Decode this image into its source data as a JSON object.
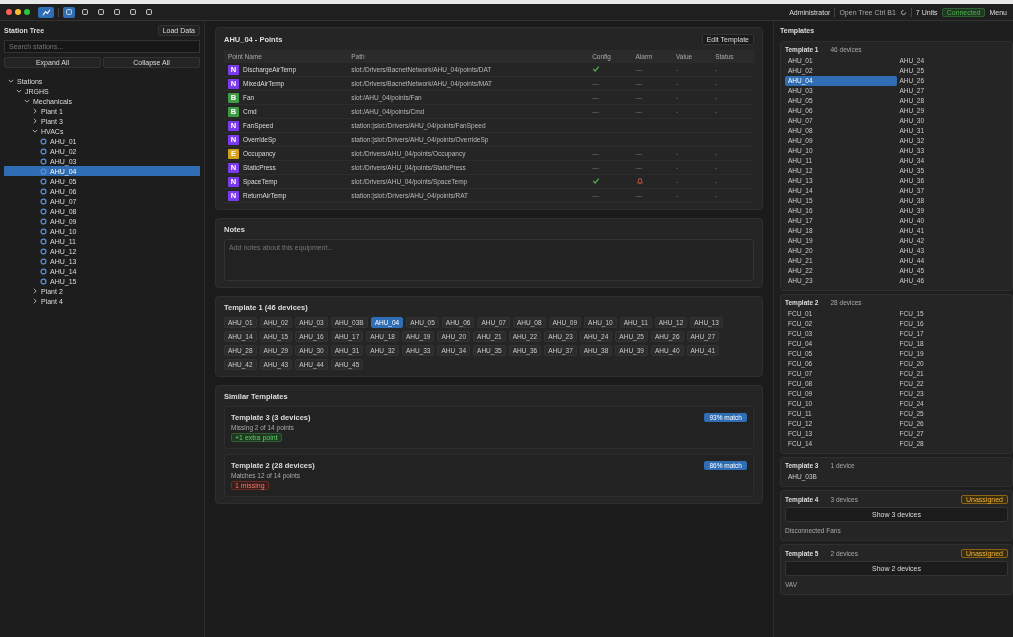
{
  "toolbar": {
    "tools": [
      {
        "selected": true
      },
      {
        "selected": false
      },
      {
        "selected": false
      },
      {
        "selected": false
      },
      {
        "selected": false
      },
      {
        "selected": false
      }
    ],
    "right": {
      "user": "Administrator",
      "workspace": "Open Tree Ctrl B1",
      "units": "7 Units",
      "status": "Connected",
      "menu": "Menu"
    }
  },
  "sidebar": {
    "title": "Station Tree",
    "load_button": "Load Data",
    "search": {
      "placeholder": "Search stations..."
    },
    "expand_button": "Expand All",
    "collapse_button": "Collapse All",
    "tree": [
      {
        "label": "Stations",
        "expanded": true,
        "selected": false,
        "children": [
          {
            "label": "JRGHS",
            "expanded": true,
            "selected": false,
            "children": [
              {
                "label": "Mechanicals",
                "expanded": true,
                "selected": false,
                "children": [
                  {
                    "label": "Plant 1",
                    "expanded": false,
                    "selected": false
                  },
                  {
                    "label": "Plant 3",
                    "expanded": false,
                    "selected": false
                  },
                  {
                    "label": "HVACs",
                    "expanded": true,
                    "selected": false,
                    "children": [
                      {
                        "label": "AHU_01",
                        "selected": false
                      },
                      {
                        "label": "AHU_02",
                        "selected": false
                      },
                      {
                        "label": "AHU_03",
                        "selected": false
                      },
                      {
                        "label": "AHU_04",
                        "selected": true
                      },
                      {
                        "label": "AHU_05",
                        "selected": false
                      },
                      {
                        "label": "AHU_06",
                        "selected": false
                      },
                      {
                        "label": "AHU_07",
                        "selected": false
                      },
                      {
                        "label": "AHU_08",
                        "selected": false
                      },
                      {
                        "label": "AHU_09",
                        "selected": false
                      },
                      {
                        "label": "AHU_10",
                        "selected": false
                      },
                      {
                        "label": "AHU_11",
                        "selected": false
                      },
                      {
                        "label": "AHU_12",
                        "selected": false
                      },
                      {
                        "label": "AHU_13",
                        "selected": false
                      },
                      {
                        "label": "AHU_14",
                        "selected": false
                      },
                      {
                        "label": "AHU_15",
                        "selected": false
                      }
                    ]
                  },
                  {
                    "label": "Plant 2",
                    "expanded": false,
                    "selected": false
                  },
                  {
                    "label": "Plant 4",
                    "expanded": false,
                    "selected": false
                  }
                ]
              }
            ]
          }
        ]
      }
    ]
  },
  "points": {
    "title": "AHU_04 - Points",
    "edit_button": "Edit Template",
    "columns": [
      "Point Name",
      "Path",
      "Config",
      "Alarm",
      "Value",
      "Status"
    ],
    "rows": [
      {
        "type": "N",
        "name": "DischargeAirTemp",
        "path": "slot:/Drivers/BacnetNetwork/AHU_04/points/DAT",
        "configured": true,
        "alarm": "—",
        "value": "-",
        "status": "-"
      },
      {
        "type": "N",
        "name": "MixedAirTemp",
        "path": "slot:/Drivers/BacnetNetwork/AHU_04/points/MAT",
        "config": "—",
        "alarm": "—",
        "value": "-",
        "status": "-"
      },
      {
        "type": "B",
        "name": "Fan",
        "path": "slot:/AHU_04/points/Fan",
        "config": "—",
        "alarm": "—",
        "value": "-",
        "status": "-"
      },
      {
        "type": "B",
        "name": "Cmd",
        "path": "slot:/AHU_04/points/Cmd",
        "config": "—",
        "alarm": "—",
        "value": "-",
        "status": "-"
      },
      {
        "type": "N",
        "name": "FanSpeed",
        "path": "station:|slot:/Drivers/AHU_04/points/FanSpeed"
      },
      {
        "type": "N",
        "name": "OverrideSp",
        "path": "station:|slot:/Drivers/AHU_04/points/OverrideSp"
      },
      {
        "type": "E",
        "name": "Occupancy",
        "path": "slot:/Drivers/AHU_04/points/Occupancy",
        "config": "—",
        "alarm": "—",
        "value": "-",
        "status": "-"
      },
      {
        "type": "N",
        "name": "StaticPress",
        "path": "slot:/Drivers/AHU_04/points/StaticPress",
        "config": "—",
        "alarm": "—",
        "value": "-",
        "status": "-"
      },
      {
        "type": "N",
        "name": "SpaceTemp",
        "path": "slot:/Drivers/AHU_04/points/SpaceTemp",
        "configured": true,
        "alarm_active": true,
        "value": "-",
        "status": "-"
      },
      {
        "type": "N",
        "name": "ReturnAirTemp",
        "path": "station:|slot:/Drivers/AHU_04/points/RAT",
        "config": "—",
        "alarm": "—",
        "value": "-",
        "status": "-"
      }
    ]
  },
  "notes": {
    "title": "Notes",
    "placeholder": "Add notes about this equipment..."
  },
  "template_devices": {
    "title": "Template 1 (46 devices)",
    "devices": [
      {
        "label": "AHU_01",
        "selected": false
      },
      {
        "label": "AHU_02",
        "selected": false
      },
      {
        "label": "AHU_03",
        "selected": false
      },
      {
        "label": "AHU_03B",
        "selected": false
      },
      {
        "label": "AHU_04",
        "selected": true
      },
      {
        "label": "AHU_05",
        "selected": false
      },
      {
        "label": "AHU_06",
        "selected": false
      },
      {
        "label": "AHU_07",
        "selected": false
      },
      {
        "label": "AHU_08",
        "selected": false
      },
      {
        "label": "AHU_09",
        "selected": false
      },
      {
        "label": "AHU_10",
        "selected": false
      },
      {
        "label": "AHU_11",
        "selected": false
      },
      {
        "label": "AHU_12",
        "selected": false
      },
      {
        "label": "AHU_13",
        "selected": false
      },
      {
        "label": "AHU_14",
        "selected": false
      },
      {
        "label": "AHU_15",
        "selected": false
      },
      {
        "label": "AHU_16",
        "selected": false
      },
      {
        "label": "AHU_17",
        "selected": false
      },
      {
        "label": "AHU_18",
        "selected": false
      },
      {
        "label": "AHU_19",
        "selected": false
      },
      {
        "label": "AHU_20",
        "selected": false
      },
      {
        "label": "AHU_21",
        "selected": false
      },
      {
        "label": "AHU_22",
        "selected": false
      },
      {
        "label": "AHU_23",
        "selected": false
      },
      {
        "label": "AHU_24",
        "selected": false
      },
      {
        "label": "AHU_25",
        "selected": false
      },
      {
        "label": "AHU_26",
        "selected": false
      },
      {
        "label": "AHU_27",
        "selected": false
      },
      {
        "label": "AHU_28",
        "selected": false
      },
      {
        "label": "AHU_29",
        "selected": false
      },
      {
        "label": "AHU_30",
        "selected": false
      },
      {
        "label": "AHU_31",
        "selected": false
      },
      {
        "label": "AHU_32",
        "selected": false
      },
      {
        "label": "AHU_33",
        "selected": false
      },
      {
        "label": "AHU_34",
        "selected": false
      },
      {
        "label": "AHU_35",
        "selected": false
      },
      {
        "label": "AHU_36",
        "selected": false
      },
      {
        "label": "AHU_37",
        "selected": false
      },
      {
        "label": "AHU_38",
        "selected": false
      },
      {
        "label": "AHU_39",
        "selected": false
      },
      {
        "label": "AHU_40",
        "selected": false
      },
      {
        "label": "AHU_41",
        "selected": false
      },
      {
        "label": "AHU_42",
        "selected": false
      },
      {
        "label": "AHU_43",
        "selected": false
      },
      {
        "label": "AHU_44",
        "selected": false
      },
      {
        "label": "AHU_45",
        "selected": false
      }
    ]
  },
  "similar": {
    "title": "Similar Templates",
    "items": [
      {
        "name": "Template 3 (3 devices)",
        "detail": "Missing 2 of 14 points",
        "tag": "+1 extra point",
        "kind": "extra",
        "match": "93% match"
      },
      {
        "name": "Template 2 (28 devices)",
        "detail": "Matches 12 of 14 points",
        "tag": "1 missing",
        "kind": "missing",
        "match": "86% match"
      }
    ]
  },
  "templates": {
    "title": "Templates",
    "items": [
      {
        "kind": "list",
        "name": "Template 1",
        "count": "46 devices",
        "devices": [
          {
            "label": "AHU_01",
            "selected": false
          },
          {
            "label": "AHU_24",
            "selected": false
          },
          {
            "label": "AHU_02",
            "selected": false
          },
          {
            "label": "AHU_25",
            "selected": false
          },
          {
            "label": "AHU_04",
            "selected": true
          },
          {
            "label": "AHU_26",
            "selected": false
          },
          {
            "label": "AHU_03",
            "selected": false
          },
          {
            "label": "AHU_27",
            "selected": false
          },
          {
            "label": "AHU_05",
            "selected": false
          },
          {
            "label": "AHU_28",
            "selected": false
          },
          {
            "label": "AHU_06",
            "selected": false
          },
          {
            "label": "AHU_29",
            "selected": false
          },
          {
            "label": "AHU_07",
            "selected": false
          },
          {
            "label": "AHU_30",
            "selected": false
          },
          {
            "label": "AHU_08",
            "selected": false
          },
          {
            "label": "AHU_31",
            "selected": false
          },
          {
            "label": "AHU_09",
            "selected": false
          },
          {
            "label": "AHU_32",
            "selected": false
          },
          {
            "label": "AHU_10",
            "selected": false
          },
          {
            "label": "AHU_33",
            "selected": false
          },
          {
            "label": "AHU_11",
            "selected": false
          },
          {
            "label": "AHU_34",
            "selected": false
          },
          {
            "label": "AHU_12",
            "selected": false
          },
          {
            "label": "AHU_35",
            "selected": false
          },
          {
            "label": "AHU_13",
            "selected": false
          },
          {
            "label": "AHU_36",
            "selected": false
          },
          {
            "label": "AHU_14",
            "selected": false
          },
          {
            "label": "AHU_37",
            "selected": false
          },
          {
            "label": "AHU_15",
            "selected": false
          },
          {
            "label": "AHU_38",
            "selected": false
          },
          {
            "label": "AHU_16",
            "selected": false
          },
          {
            "label": "AHU_39",
            "selected": false
          },
          {
            "label": "AHU_17",
            "selected": false
          },
          {
            "label": "AHU_40",
            "selected": false
          },
          {
            "label": "AHU_18",
            "selected": false
          },
          {
            "label": "AHU_41",
            "selected": false
          },
          {
            "label": "AHU_19",
            "selected": false
          },
          {
            "label": "AHU_42",
            "selected": false
          },
          {
            "label": "AHU_20",
            "selected": false
          },
          {
            "label": "AHU_43",
            "selected": false
          },
          {
            "label": "AHU_21",
            "selected": false
          },
          {
            "label": "AHU_44",
            "selected": false
          },
          {
            "label": "AHU_22",
            "selected": false
          },
          {
            "label": "AHU_45",
            "selected": false
          },
          {
            "label": "AHU_23",
            "selected": false
          },
          {
            "label": "AHU_46",
            "selected": false
          }
        ]
      },
      {
        "kind": "list",
        "name": "Template 2",
        "count": "28 devices",
        "devices": [
          {
            "label": "FCU_01",
            "selected": false
          },
          {
            "label": "FCU_15",
            "selected": false
          },
          {
            "label": "FCU_02",
            "selected": false
          },
          {
            "label": "FCU_16",
            "selected": false
          },
          {
            "label": "FCU_03",
            "selected": false
          },
          {
            "label": "FCU_17",
            "selected": false
          },
          {
            "label": "FCU_04",
            "selected": false
          },
          {
            "label": "FCU_18",
            "selected": false
          },
          {
            "label": "FCU_05",
            "selected": false
          },
          {
            "label": "FCU_19",
            "selected": false
          },
          {
            "label": "FCU_06",
            "selected": false
          },
          {
            "label": "FCU_20",
            "selected": false
          },
          {
            "label": "FCU_07",
            "selected": false
          },
          {
            "label": "FCU_21",
            "selected": false
          },
          {
            "label": "FCU_08",
            "selected": false
          },
          {
            "label": "FCU_22",
            "selected": false
          },
          {
            "label": "FCU_09",
            "selected": false
          },
          {
            "label": "FCU_23",
            "selected": false
          },
          {
            "label": "FCU_10",
            "selected": false
          },
          {
            "label": "FCU_24",
            "selected": false
          },
          {
            "label": "FCU_11",
            "selected": false
          },
          {
            "label": "FCU_25",
            "selected": false
          },
          {
            "label": "FCU_12",
            "selected": false
          },
          {
            "label": "FCU_26",
            "selected": false
          },
          {
            "label": "FCU_13",
            "selected": false
          },
          {
            "label": "FCU_27",
            "selected": false
          },
          {
            "label": "FCU_14",
            "selected": false
          },
          {
            "label": "FCU_28",
            "selected": false
          }
        ]
      },
      {
        "kind": "list",
        "name": "Template 3",
        "count": "1 device",
        "devices": [
          {
            "label": "AHU_03B",
            "selected": false
          }
        ]
      },
      {
        "kind": "collapsed",
        "name": "Template 4",
        "count": "3 devices",
        "badge": "Unassigned",
        "show_button": "Show 3 devices",
        "description": "Disconnected Fans"
      },
      {
        "kind": "collapsed",
        "name": "Template 5",
        "count": "2 devices",
        "badge": "Unassigned",
        "show_button": "Show 2 devices",
        "description": "VAV"
      }
    ]
  }
}
